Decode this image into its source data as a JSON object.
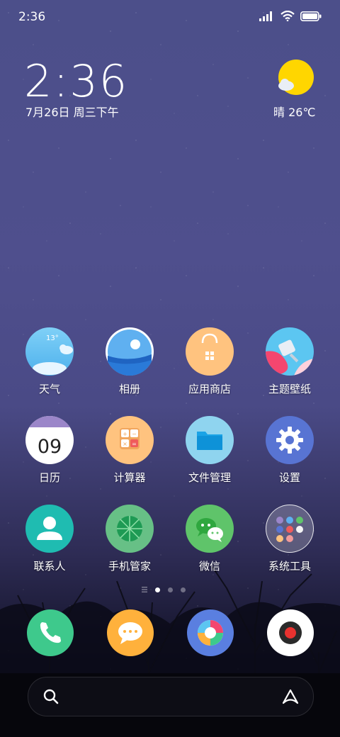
{
  "status": {
    "time": "2:36"
  },
  "lockscreen": {
    "clock": "2:36",
    "date": "7月26日 周三下午",
    "weather": "晴 26℃"
  },
  "apps": {
    "row1": [
      {
        "label": "天气",
        "icon": "weather-icon",
        "badge_text": "13°"
      },
      {
        "label": "相册",
        "icon": "gallery-icon"
      },
      {
        "label": "应用商店",
        "icon": "app-store-icon"
      },
      {
        "label": "主题壁纸",
        "icon": "themes-icon"
      }
    ],
    "row2": [
      {
        "label": "日历",
        "icon": "calendar-icon",
        "day": "09"
      },
      {
        "label": "计算器",
        "icon": "calculator-icon"
      },
      {
        "label": "文件管理",
        "icon": "file-manager-icon"
      },
      {
        "label": "设置",
        "icon": "settings-icon"
      }
    ],
    "row3": [
      {
        "label": "联系人",
        "icon": "contacts-icon"
      },
      {
        "label": "手机管家",
        "icon": "security-icon"
      },
      {
        "label": "微信",
        "icon": "wechat-icon"
      },
      {
        "label": "系统工具",
        "icon": "system-tools-folder-icon"
      }
    ]
  },
  "dock": [
    {
      "icon": "phone-icon"
    },
    {
      "icon": "messages-icon"
    },
    {
      "icon": "browser-icon"
    },
    {
      "icon": "camera-icon"
    }
  ],
  "page_indicator": {
    "pages": 3,
    "current": 1
  },
  "colors": {
    "accent_weather_sun": "#ffd600",
    "phone_green": "#3ec98c"
  }
}
